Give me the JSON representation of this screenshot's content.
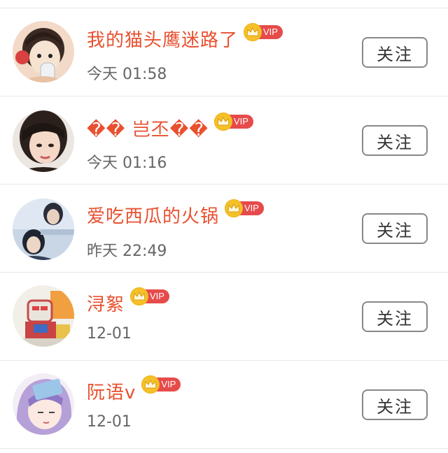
{
  "vip_label": "VIP",
  "follow_label": "关注",
  "colors": {
    "name": "#e8502f",
    "vip_tag": "#e64b4b",
    "crown": "#f5c12a",
    "time": "#666666",
    "divider": "#e8e8e8"
  },
  "users": [
    {
      "name": "我的猫头鹰迷路了",
      "time": "今天 01:58",
      "avatar": "cartoon-girl-avatar"
    },
    {
      "name": "�� 岂丕��",
      "time": "今天 01:16",
      "avatar": "girl-photo-avatar"
    },
    {
      "name": "爱吃西瓜的火锅",
      "time": "昨天 22:49",
      "avatar": "boys-photo-avatar"
    },
    {
      "name": "浔絮",
      "time": "12-01",
      "avatar": "robot-avatar"
    },
    {
      "name": "阮语v",
      "time": "12-01",
      "avatar": "anime-girl-avatar"
    }
  ]
}
